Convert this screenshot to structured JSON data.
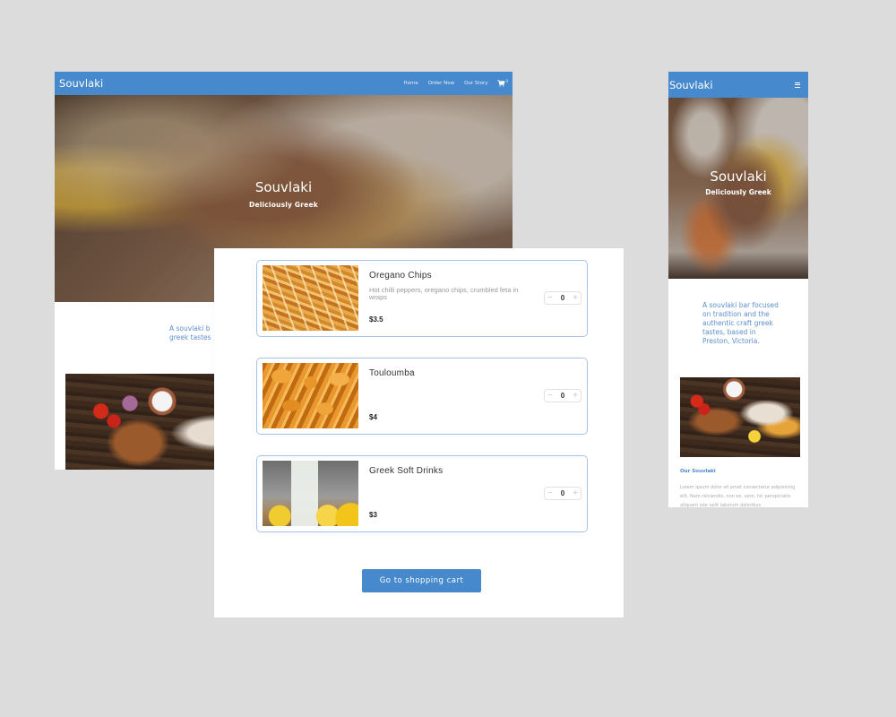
{
  "brand": {
    "name": "Souvlaki",
    "accent_color": "#4689cc"
  },
  "desktop": {
    "nav": {
      "links": [
        {
          "label": "Home"
        },
        {
          "label": "Order Now"
        },
        {
          "label": "Our Story"
        }
      ],
      "cart_icon": "shopping-cart-icon",
      "cart_count": "0"
    },
    "hero": {
      "title": "Souvlaki",
      "subtitle": "Deliciously Greek"
    },
    "tagline_visible": "A souvlaki b\ngreek tastes"
  },
  "menu": {
    "items": [
      {
        "name": "Oregano Chips",
        "description": "Hot chilli peppers, oregano chips, crumbled feta in wraps",
        "price": "$3.5",
        "quantity": "0",
        "image": "oregano-chips-photo"
      },
      {
        "name": "Touloumba",
        "description": "",
        "price": "$4",
        "quantity": "0",
        "image": "touloumba-photo"
      },
      {
        "name": "Greek Soft Drinks",
        "description": "",
        "price": "$3",
        "quantity": "0",
        "image": "greek-soft-drinks-photo"
      }
    ],
    "stepper": {
      "minus": "−",
      "plus": "+"
    },
    "cart_button_label": "Go to shopping cart"
  },
  "mobile": {
    "nav": {
      "menu_icon": "hamburger-menu-icon"
    },
    "hero": {
      "title": "Souvlaki",
      "subtitle": "Deliciously Greek"
    },
    "tagline": "A souvlaki bar focused on tradition and the authentic craft greek tastes, based in Preston, Victoria.",
    "section_title": "Our Souvlaki",
    "section_body": "Lorem ipsum dolor sit amet consectetur adipisicing elit. Nam reiciendis, non ex, vero, hic perspiciatis aliquam iste velit laborum doloribus"
  }
}
